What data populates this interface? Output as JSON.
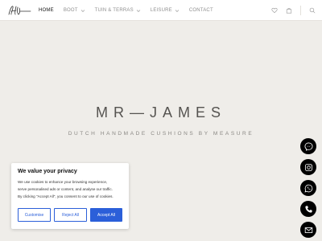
{
  "nav": {
    "items": [
      {
        "label": "HOME",
        "active": true,
        "dropdown": false
      },
      {
        "label": "BOOT",
        "active": false,
        "dropdown": true
      },
      {
        "label": "TUIN & TERRAS",
        "active": false,
        "dropdown": true
      },
      {
        "label": "LEISURE",
        "active": false,
        "dropdown": true
      },
      {
        "label": "CONTACT",
        "active": false,
        "dropdown": false
      }
    ]
  },
  "header_icons": [
    "heart-icon",
    "bag-icon",
    "search-icon"
  ],
  "hero": {
    "brand": "MR—JAMES",
    "tagline": "DUTCH HANDMADE CUSHIONS BY MEASURE"
  },
  "social": [
    "messenger-icon",
    "instagram-icon",
    "whatsapp-icon",
    "phone-icon",
    "email-icon"
  ],
  "cookie": {
    "title": "We value your privacy",
    "lines": [
      "We use cookies to enhance your browsing experience,",
      "serve personalised ads or content, and analyse our traffic.",
      "By clicking \"Accept All\", you consent to our use of cookies."
    ],
    "buttons": {
      "customise": "Customise",
      "reject": "Reject All",
      "accept": "Accept All"
    }
  },
  "colors": {
    "background": "#efede9",
    "accent_blue": "#2b5fd9",
    "social_bg": "#000000"
  }
}
